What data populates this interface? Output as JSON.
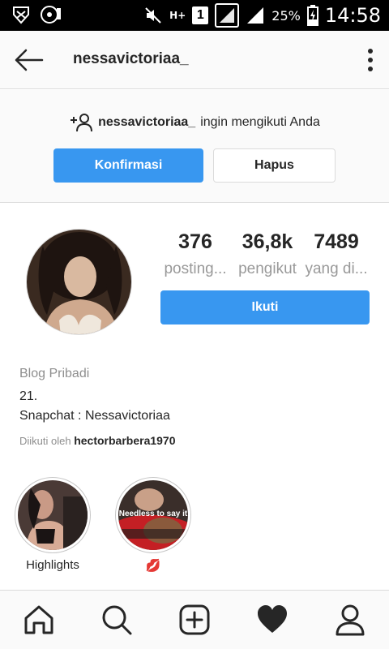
{
  "status_bar": {
    "battery": "25%",
    "time": "14:58",
    "network": "H+",
    "sim": "1"
  },
  "app_bar": {
    "username": "nessavictoriaa_",
    "icons": [
      "back-arrow-icon",
      "more-vertical-icon"
    ]
  },
  "follow_request": {
    "username": "nessavictoriaa_",
    "message": "ingin mengikuti Anda",
    "confirm_label": "Konfirmasi",
    "delete_label": "Hapus"
  },
  "profile": {
    "stats": [
      {
        "value": "376",
        "label": "posting..."
      },
      {
        "value": "36,8k",
        "label": "pengikut"
      },
      {
        "value": "7489",
        "label": "yang di..."
      }
    ],
    "follow_label": "Ikuti",
    "category": "Blog Pribadi",
    "bio_line1": "21.",
    "bio_line2": "Snapchat : Nessavictoriaa",
    "followed_by_prefix": "Diikuti oleh",
    "followed_by_user": "hectorbarbera1970"
  },
  "highlights": [
    {
      "name": "Highlights",
      "caption": ""
    },
    {
      "name": "💋",
      "caption": "Needless to say it"
    }
  ],
  "bottom_nav": [
    "home-icon",
    "search-icon",
    "add-post-icon",
    "activity-heart-icon",
    "profile-icon"
  ],
  "colors": {
    "accent": "#3897f0",
    "text": "#262626",
    "muted": "#999999",
    "border": "#dbdbdb",
    "statusbar": "#000000"
  }
}
